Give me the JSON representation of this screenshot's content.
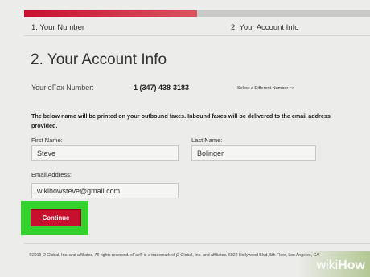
{
  "progress": {
    "fraction": 0.5,
    "color": "#c8102e"
  },
  "steps": [
    "1. Your Number",
    "2. Your Account Info"
  ],
  "page_title": "2. Your Account Info",
  "efax": {
    "label": "Your eFax Number:",
    "number": "1 (347) 438-3183",
    "select_link": "Select a Different Number >>"
  },
  "notice": "The below name will be printed on your outbound faxes. Inbound faxes will be delivered to the email address provided.",
  "form": {
    "first_name_label": "First Name:",
    "first_name_value": "Steve",
    "last_name_label": "Last Name:",
    "last_name_value": "Bolinger",
    "email_label": "Email Address:",
    "email_value": "wikihowsteve@gmail.com"
  },
  "continue_label": "Continue",
  "footer": "©2019 j2 Global, Inc. and affiliates. All rights reserved. eFax® is a trademark of j2 Global, Inc. and affiliates. 6922 Hollywood Blvd, 5th Floor, Los Angeles, CA",
  "watermark": {
    "wiki": "wiki",
    "how": "How"
  },
  "colors": {
    "accent": "#c8102e",
    "highlight": "#35d12c",
    "background": "#ececea"
  }
}
